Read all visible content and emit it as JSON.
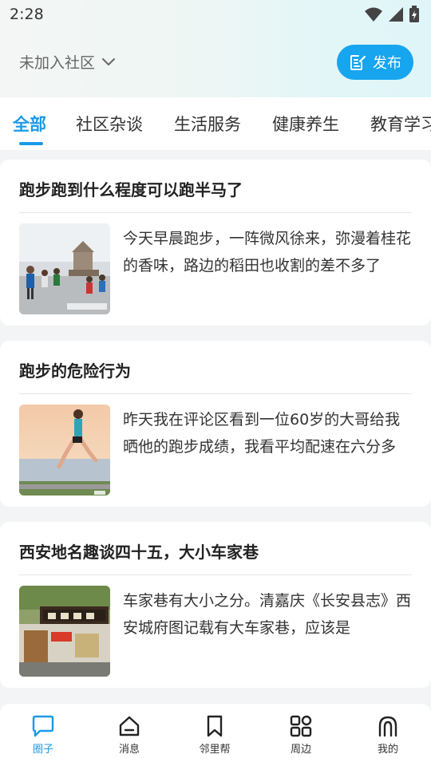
{
  "status_bar": {
    "time": "2:28",
    "icons": [
      "wifi-icon",
      "signal-icon",
      "battery-charging-icon"
    ]
  },
  "header": {
    "community_label": "未加入社区",
    "publish_label": "发布",
    "accent_color": "#17a5ef"
  },
  "tabs": [
    {
      "label": "全部",
      "active": true
    },
    {
      "label": "社区杂谈",
      "active": false
    },
    {
      "label": "生活服务",
      "active": false
    },
    {
      "label": "健康养生",
      "active": false
    },
    {
      "label": "教育学习",
      "active": false
    }
  ],
  "posts": [
    {
      "title": "跑步跑到什么程度可以跑半马了",
      "excerpt": "今天早晨跑步，一阵微风徐来，弥漫着桂花的香味，路边的稻田也收割的差不多了",
      "thumbnail": "marathon-crowd-image"
    },
    {
      "title": "跑步的危险行为",
      "excerpt": "昨天我在评论区看到一位60岁的大哥给我晒他的跑步成绩，我看平均配速在六分多",
      "thumbnail": "woman-running-lakeside-image"
    },
    {
      "title": "西安地名趣谈四十五，大小车家巷",
      "excerpt": "车家巷有大小之分。清嘉庆《长安县志》西安城府图记载有大车家巷，应该是",
      "thumbnail": "street-sign-image"
    }
  ],
  "bottom_nav": [
    {
      "label": "圈子",
      "icon": "chat-bubble-icon",
      "active": true
    },
    {
      "label": "消息",
      "icon": "home-icon",
      "active": false
    },
    {
      "label": "邻里帮",
      "icon": "bookmark-icon",
      "active": false
    },
    {
      "label": "周边",
      "icon": "grid-icon",
      "active": false
    },
    {
      "label": "我的",
      "icon": "profile-icon",
      "active": false
    }
  ]
}
